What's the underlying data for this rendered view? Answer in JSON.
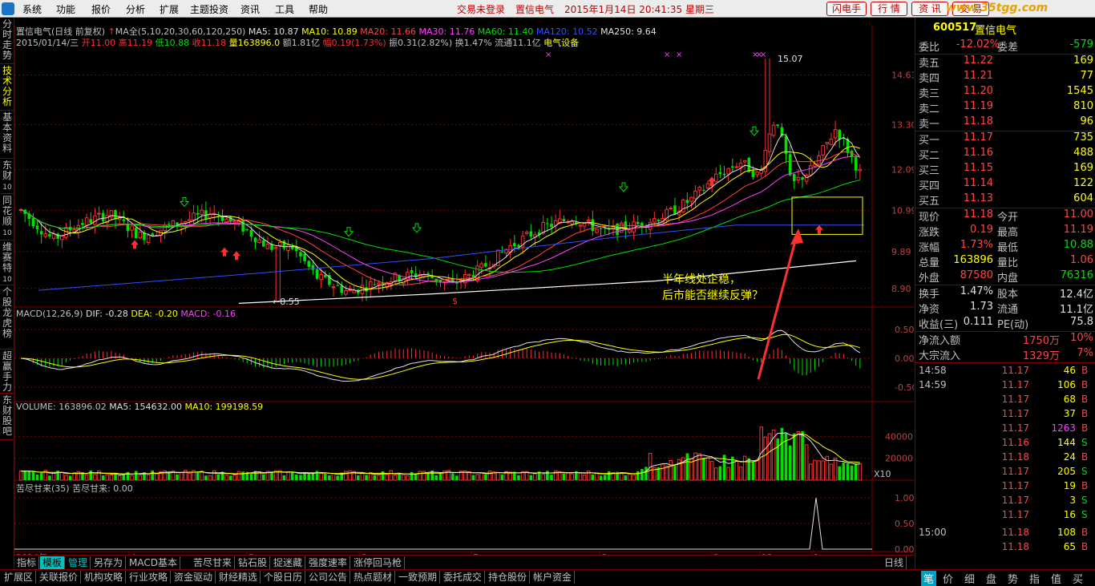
{
  "menu": {
    "items": [
      "系统",
      "功能",
      "报价",
      "分析",
      "扩展",
      "主题投资",
      "资讯",
      "工具",
      "帮助"
    ],
    "login_status": "交易未登录",
    "stock_name": "置信电气",
    "datetime": "2015年1月14日  20:41:35  星期三",
    "buttons": [
      "闪电手",
      "行 情",
      "资 讯",
      "交 易"
    ],
    "watermark": "www.35tgg.com"
  },
  "left_tabs": [
    {
      "label": "分时走势",
      "sub": ""
    },
    {
      "label": "技术分析",
      "sub": "",
      "active": true
    },
    {
      "label": "基本资料",
      "sub": ""
    },
    {
      "label": "东财",
      "sub": "10"
    },
    {
      "label": "同花顺",
      "sub": "10"
    },
    {
      "label": "维赛特",
      "sub": "10"
    },
    {
      "label": "个股龙虎榜",
      "sub": ""
    },
    {
      "label": "超赢手力",
      "sub": ""
    },
    {
      "label": "东财股吧",
      "sub": ""
    }
  ],
  "chart": {
    "title_line1": {
      "name": "置信电气(日线 前复权)",
      "ma_label": "MA全(5,10,20,30,60,120,250)",
      "ma_values": [
        {
          "label": "MA5: 10.87",
          "color": "#e0e0e0"
        },
        {
          "label": "MA10: 10.89",
          "color": "#ffff00"
        },
        {
          "label": "MA20: 11.66",
          "color": "#ff4545"
        },
        {
          "label": "MA30: 11.76",
          "color": "#ff40ff"
        },
        {
          "label": "MA60: 11.40",
          "color": "#00e000"
        },
        {
          "label": "MA120: 10.52",
          "color": "#3050ff"
        },
        {
          "label": "MA250: 9.64",
          "color": "#e0e0e0"
        }
      ]
    },
    "title_line2": {
      "date": "2015/01/14/三",
      "open": "开11.00",
      "high": "高11.19",
      "low": "低10.88",
      "close": "收11.18",
      "volume": "量163896.0",
      "amount": "额1.81亿",
      "change": "幅0.19(1.73%)",
      "amplitude": "振0.31(2.82%)",
      "turnover": "换1.47%",
      "float": "流通11.1亿",
      "sector": "电气设备"
    },
    "price_axis": [
      "14.63",
      "13.30",
      "12.09",
      "10.99",
      "9.89",
      "8.90"
    ],
    "high_marker": "15.07",
    "low_marker": "8.55",
    "annotation_line1": "半年线处企稳，",
    "annotation_line2": "后市能否继续反弹？",
    "macd_title": {
      "name": "MACD(12,26,9)",
      "dif": "DIF: -0.28",
      "dea": "DEA: -0.20",
      "macd": "MACD: -0.16"
    },
    "macd_axis": [
      "0.50",
      "0.00",
      "-0.50"
    ],
    "vol_title": {
      "name": "VOLUME: 163896.02",
      "ma5": "MA5: 154632.00",
      "ma10": "MA10: 199198.59"
    },
    "vol_axis": [
      "40000",
      "20000"
    ],
    "vol_unit": "X10",
    "kj_title": {
      "name": "苦尽甘来(35)",
      "val": "苦尽甘来: 0.00"
    },
    "kj_axis": [
      "1.00",
      "0.50",
      "0.00"
    ],
    "x_labels": [
      "2014年",
      "4",
      "5",
      "6",
      "7",
      "8",
      "9",
      "12",
      "1"
    ],
    "period": "日线"
  },
  "bottom_tabs": [
    "指标",
    "模板",
    "管理",
    "另存为",
    "MACD基本",
    "苦尽甘来",
    "钻石股",
    "捉迷藏",
    "强度速率",
    "涨停回马枪"
  ],
  "status_tabs": [
    "扩展区",
    "关联报价",
    "机构攻略",
    "行业攻略",
    "资金驱动",
    "财经精选",
    "个股日历",
    "公司公告",
    "热点题材",
    "一致预期",
    "委托成交",
    "持仓股份",
    "帐户资金"
  ],
  "quote": {
    "code": "600517",
    "name": "置信电气",
    "weibi": {
      "label": "委比",
      "value": "-12.02%",
      "label2": "委差",
      "value2": "-579"
    },
    "asks": [
      {
        "label": "卖五",
        "price": "11.22",
        "vol": "169"
      },
      {
        "label": "卖四",
        "price": "11.21",
        "vol": "77"
      },
      {
        "label": "卖三",
        "price": "11.20",
        "vol": "1545"
      },
      {
        "label": "卖二",
        "price": "11.19",
        "vol": "810"
      },
      {
        "label": "卖一",
        "price": "11.18",
        "vol": "96"
      }
    ],
    "bids": [
      {
        "label": "买一",
        "price": "11.17",
        "vol": "735"
      },
      {
        "label": "买二",
        "price": "11.16",
        "vol": "488"
      },
      {
        "label": "买三",
        "price": "11.15",
        "vol": "169"
      },
      {
        "label": "买四",
        "price": "11.14",
        "vol": "122"
      },
      {
        "label": "买五",
        "price": "11.13",
        "vol": "604"
      }
    ],
    "stats": [
      {
        "l1": "现价",
        "v1": "11.18",
        "c1": "red",
        "l2": "今开",
        "v2": "11.00",
        "c2": "red"
      },
      {
        "l1": "涨跌",
        "v1": "0.19",
        "c1": "red",
        "l2": "最高",
        "v2": "11.19",
        "c2": "red"
      },
      {
        "l1": "涨幅",
        "v1": "1.73%",
        "c1": "red",
        "l2": "最低",
        "v2": "10.88",
        "c2": "grn"
      },
      {
        "l1": "总量",
        "v1": "163896",
        "c1": "yel",
        "l2": "量比",
        "v2": "1.06",
        "c2": "red"
      },
      {
        "l1": "外盘",
        "v1": "87580",
        "c1": "red",
        "l2": "内盘",
        "v2": "76316",
        "c2": "grn"
      }
    ],
    "stats2": [
      {
        "l1": "换手",
        "v1": "1.47%",
        "l2": "股本",
        "v2": "12.4亿"
      },
      {
        "l1": "净资",
        "v1": "1.73",
        "l2": "流通",
        "v2": "11.1亿"
      },
      {
        "l1": "收益(三)",
        "v1": "0.111",
        "l2": "PE(动)",
        "v2": "75.8"
      }
    ],
    "flow": [
      {
        "label": "净流入额",
        "v1": "1750万",
        "v2": "10%"
      },
      {
        "label": "大宗流入",
        "v1": "1329万",
        "v2": "7%"
      }
    ],
    "ticks": [
      {
        "t": "14:58",
        "p": "11.17",
        "q": "46",
        "s": "B",
        "qc": "yel"
      },
      {
        "t": "14:59",
        "p": "11.17",
        "q": "106",
        "s": "B",
        "qc": "yel"
      },
      {
        "t": "",
        "p": "11.17",
        "q": "68",
        "s": "B",
        "qc": "yel"
      },
      {
        "t": "",
        "p": "11.17",
        "q": "37",
        "s": "B",
        "qc": "yel"
      },
      {
        "t": "",
        "p": "11.17",
        "q": "1263",
        "s": "B",
        "qc": "mag"
      },
      {
        "t": "",
        "p": "11.16",
        "q": "144",
        "s": "S",
        "qc": "yel"
      },
      {
        "t": "",
        "p": "11.18",
        "q": "24",
        "s": "B",
        "qc": "yel"
      },
      {
        "t": "",
        "p": "11.17",
        "q": "205",
        "s": "S",
        "qc": "yel"
      },
      {
        "t": "",
        "p": "11.17",
        "q": "19",
        "s": "B",
        "qc": "yel"
      },
      {
        "t": "",
        "p": "11.17",
        "q": "3",
        "s": "S",
        "qc": "yel"
      },
      {
        "t": "",
        "p": "11.17",
        "q": "16",
        "s": "S",
        "qc": "yel"
      },
      {
        "t": "15:00",
        "p": "11.18",
        "q": "108",
        "s": "B",
        "qc": "yel"
      },
      {
        "t": "",
        "p": "11.18",
        "q": "65",
        "s": "B",
        "qc": "yel"
      }
    ],
    "bottom_tabs": [
      "笔",
      "价",
      "细",
      "盘",
      "势",
      "指",
      "值",
      "买"
    ]
  }
}
